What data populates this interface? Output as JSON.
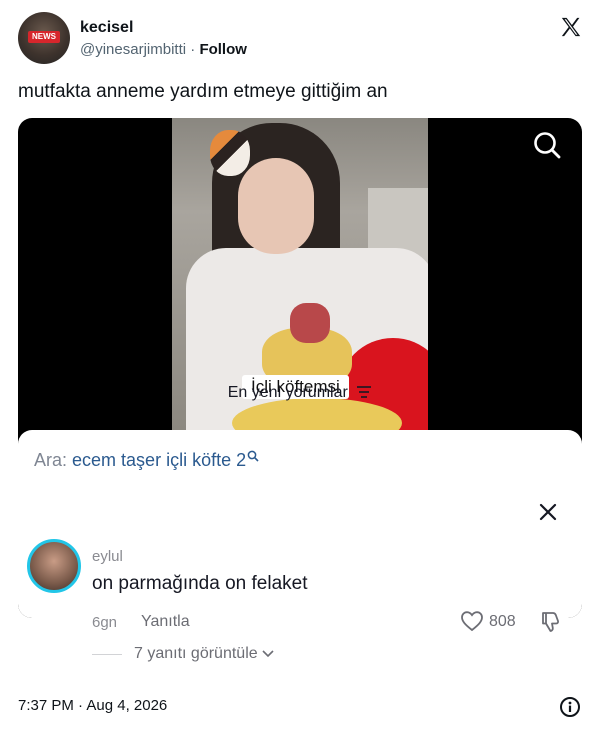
{
  "author": {
    "name": "kecisel",
    "handle": "@yinesarjimbitti",
    "separator": "·",
    "follow_label": "Follow",
    "avatar_badge": "NEWS"
  },
  "tweet": {
    "text": "mutfakta anneme yardım etmeye gittiğim an"
  },
  "video": {
    "subtitle": "İçli köftemsi"
  },
  "search": {
    "prefix": "Ara:",
    "query": "ecem taşer içli köfte 2"
  },
  "comments": {
    "title": "En yeni yorumlar",
    "items": [
      {
        "user": "eylul",
        "text": "on parmağında on felaket",
        "age": "6gn",
        "reply_label": "Yanıtla",
        "likes": "808",
        "view_replies": "7 yanıtı görüntüle"
      }
    ]
  },
  "footer": {
    "timestamp": "7:37 PM · Aug 4, 2026"
  },
  "colors": {
    "accent_ring": "#22c6e8",
    "search_query": "#2b5a8f"
  }
}
